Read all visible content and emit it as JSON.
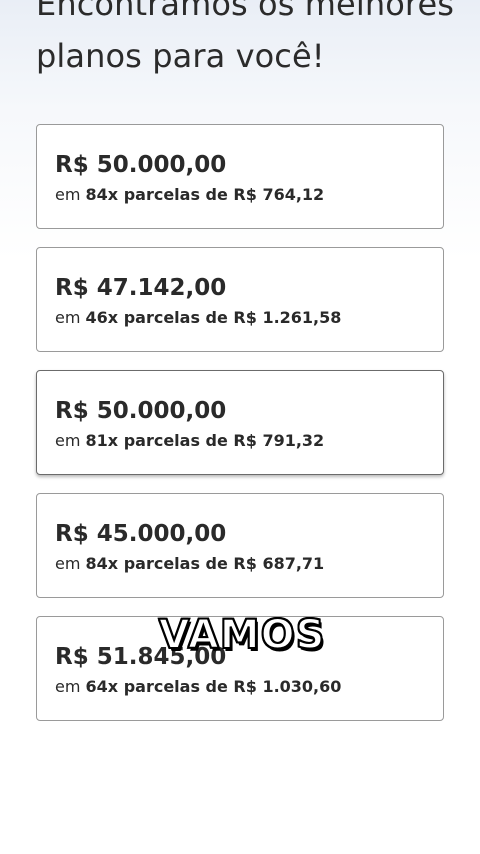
{
  "header": {
    "title_line1": "Encontramos os melhores",
    "title_line2": "planos para você!"
  },
  "plans": [
    {
      "amount": "R$ 50.000,00",
      "prefix": "em",
      "details": "84x parcelas de R$ 764,12"
    },
    {
      "amount": "R$ 47.142,00",
      "prefix": "em",
      "details": "46x parcelas de R$ 1.261,58"
    },
    {
      "amount": "R$ 50.000,00",
      "prefix": "em",
      "details": "81x parcelas de R$ 791,32"
    },
    {
      "amount": "R$ 45.000,00",
      "prefix": "em",
      "details": "84x parcelas de R$ 687,71"
    },
    {
      "amount": "R$ 51.845,00",
      "prefix": "em",
      "details": "64x parcelas de R$ 1.030,60"
    }
  ],
  "overlay": {
    "caption": "VAMOS"
  },
  "colors": {
    "text": "#2a2a2a",
    "card_border": "#9a9a9a",
    "background_top": "#e9eef6"
  }
}
